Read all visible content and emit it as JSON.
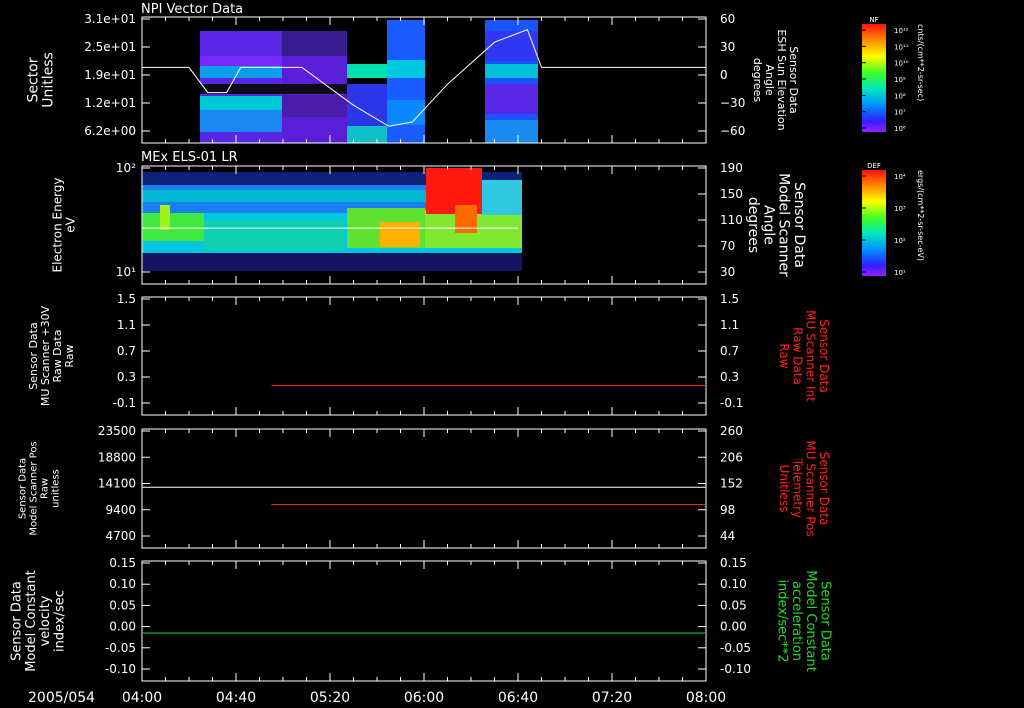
{
  "date_label": "2005/054",
  "time_ticks": [
    "04:00",
    "04:40",
    "05:20",
    "06:00",
    "06:40",
    "07:20",
    "08:00"
  ],
  "colors": {
    "white": "#ffffff",
    "red": "#ff2020",
    "green": "#22dd22",
    "background": "#000000"
  },
  "colorbars": [
    {
      "tag": "NF",
      "units": "cnts/(cm**2-sr-sec)",
      "ticks": [
        "10¹²",
        "10¹¹",
        "10¹⁰",
        "10⁹",
        "10⁸",
        "10⁷",
        "10⁶"
      ]
    },
    {
      "tag": "DEF",
      "units": "ergs/(cm**2-sr-sec-eV)",
      "ticks": [
        "10⁴",
        "10³",
        "10²",
        "10¹"
      ]
    }
  ],
  "chart_data": [
    {
      "type": "heatmap",
      "title": "NPI Vector Data",
      "ylabel": [
        "Sector",
        "Unitless"
      ],
      "yticks": [
        "3.1e+01",
        "2.5e+01",
        "1.9e+01",
        "1.2e+01",
        "6.2e+00"
      ],
      "y2label": [
        "Sensor Data",
        "ESH Sun Elevation",
        "Angle",
        "degrees"
      ],
      "y2ticks": [
        "60",
        "30",
        "0",
        "−30",
        "−60"
      ],
      "y2lim": [
        -90,
        60
      ],
      "line": {
        "color": "#ffffff",
        "x": [
          "04:00",
          "04:20",
          "04:28",
          "04:36",
          "04:42",
          "05:08",
          "05:30",
          "05:45",
          "05:55",
          "06:10",
          "06:30",
          "06:44",
          "06:50",
          "08:00"
        ],
        "y": [
          0,
          0,
          -30,
          -30,
          0,
          0,
          -45,
          -70,
          -65,
          -20,
          30,
          45,
          0,
          0
        ]
      }
    },
    {
      "type": "heatmap",
      "title": "MEx ELS-01 LR",
      "ylabel": [
        "Electron Energy",
        "eV"
      ],
      "yticks": [
        "10²",
        "10¹"
      ],
      "y2label": [
        "Sensor Data",
        "Model Scanner",
        "Angle",
        "degrees"
      ],
      "y2ticks": [
        "190",
        "150",
        "110",
        "70",
        "30"
      ],
      "y2lim": [
        0,
        190
      ],
      "line": {
        "color": "#ffffff",
        "x": [
          "04:00",
          "06:40"
        ],
        "y": [
          90,
          90
        ]
      }
    },
    {
      "type": "line",
      "ylabel": [
        "Sensor Data",
        "MU Scanner +30V",
        "Raw Data",
        "Raw"
      ],
      "yticks": [
        "1.5",
        "1.1",
        "0.7",
        "0.3",
        "-0.1"
      ],
      "y2label": [
        "Sensor Data",
        "MU Scanner Int",
        "Raw Data",
        "Raw"
      ],
      "y2ticks": [
        "1.5",
        "1.1",
        "0.7",
        "0.3",
        "-0.1"
      ],
      "ylim": [
        -0.5,
        1.5
      ],
      "series": [
        {
          "color": "#ff2020",
          "x": [
            "04:55",
            "08:00"
          ],
          "y": [
            0.0,
            0.0
          ]
        }
      ]
    },
    {
      "type": "line",
      "ylabel": [
        "Sensor Data",
        "Model Scanner Pos",
        "Raw",
        "unitless"
      ],
      "yticks": [
        "23500",
        "18800",
        "14100",
        "9400",
        "4700"
      ],
      "y2label": [
        "Sensor Data",
        "MU Scanner Pos",
        "Telemetry",
        "Unitless"
      ],
      "y2ticks": [
        "260",
        "206",
        "152",
        "98",
        "44"
      ],
      "ylim": [
        0,
        23500
      ],
      "series": [
        {
          "color": "#ffffff",
          "x": [
            "04:00",
            "08:00"
          ],
          "y": [
            12000,
            12000
          ]
        },
        {
          "color": "#ff2020",
          "x": [
            "04:55",
            "08:00"
          ],
          "y": [
            8600,
            8600
          ]
        }
      ]
    },
    {
      "type": "line",
      "ylabel": [
        "Sensor Data",
        "Model Constant",
        "velocity",
        "index/sec"
      ],
      "yticks": [
        "0.15",
        "0.10",
        "0.05",
        "0.00",
        "-0.05",
        "-0.10"
      ],
      "y2label": [
        "Sensor Data",
        "Model Constant",
        "acceleration",
        "index/sec**2"
      ],
      "y2ticks": [
        "0.15",
        "0.10",
        "0.05",
        "0.00",
        "-0.05",
        "-0.10"
      ],
      "ylim": [
        -0.1,
        0.15
      ],
      "series": [
        {
          "color": "#22dd22",
          "x": [
            "04:00",
            "08:00"
          ],
          "y": [
            0.0,
            0.0
          ]
        }
      ]
    }
  ]
}
